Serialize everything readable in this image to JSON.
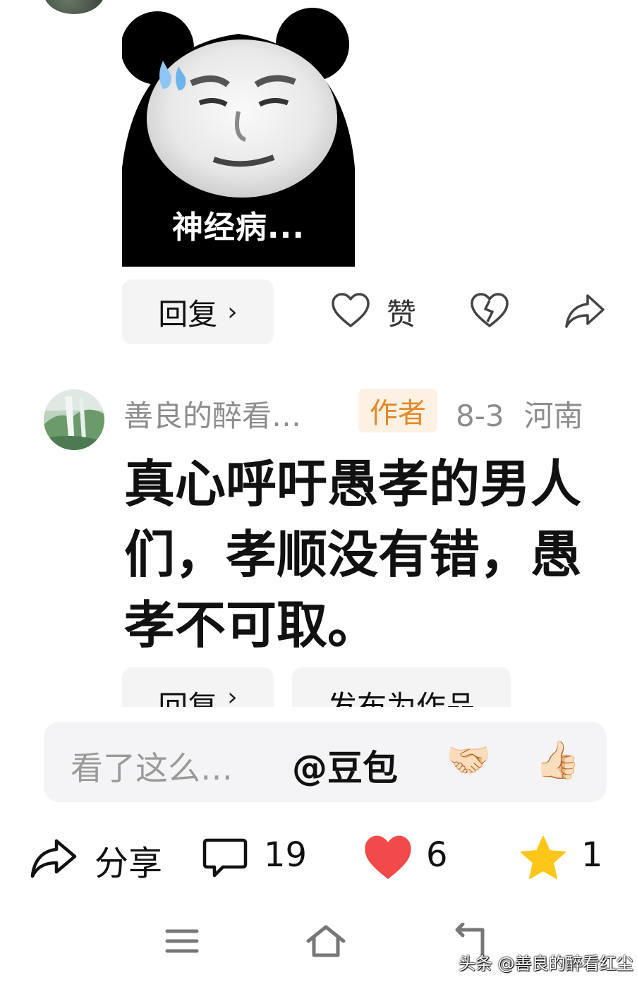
{
  "meme": {
    "caption": "神经病..."
  },
  "comment1": {
    "reply_label": "回复",
    "like_label": "赞"
  },
  "comment2": {
    "username": "善良的醉看…",
    "author_badge": "作者",
    "date": "8-3",
    "location": "河南",
    "text": "真心呼吁愚孝的男人们，孝顺没有错，愚孝不可取。",
    "reply_label": "回复",
    "publish_label": "发布为作品"
  },
  "input_bar": {
    "placeholder": "看了这么…",
    "mention": "@豆包",
    "emoji_1": "🤝🏻",
    "emoji_2": "👍🏻"
  },
  "action_bar": {
    "share_label": "分享",
    "comment_count": "19",
    "like_count": "6",
    "favorite_count": "1",
    "like_color": "#f24a4a",
    "favorite_color": "#ffc61a"
  },
  "watermark": "头条 @善良的醉看红尘"
}
